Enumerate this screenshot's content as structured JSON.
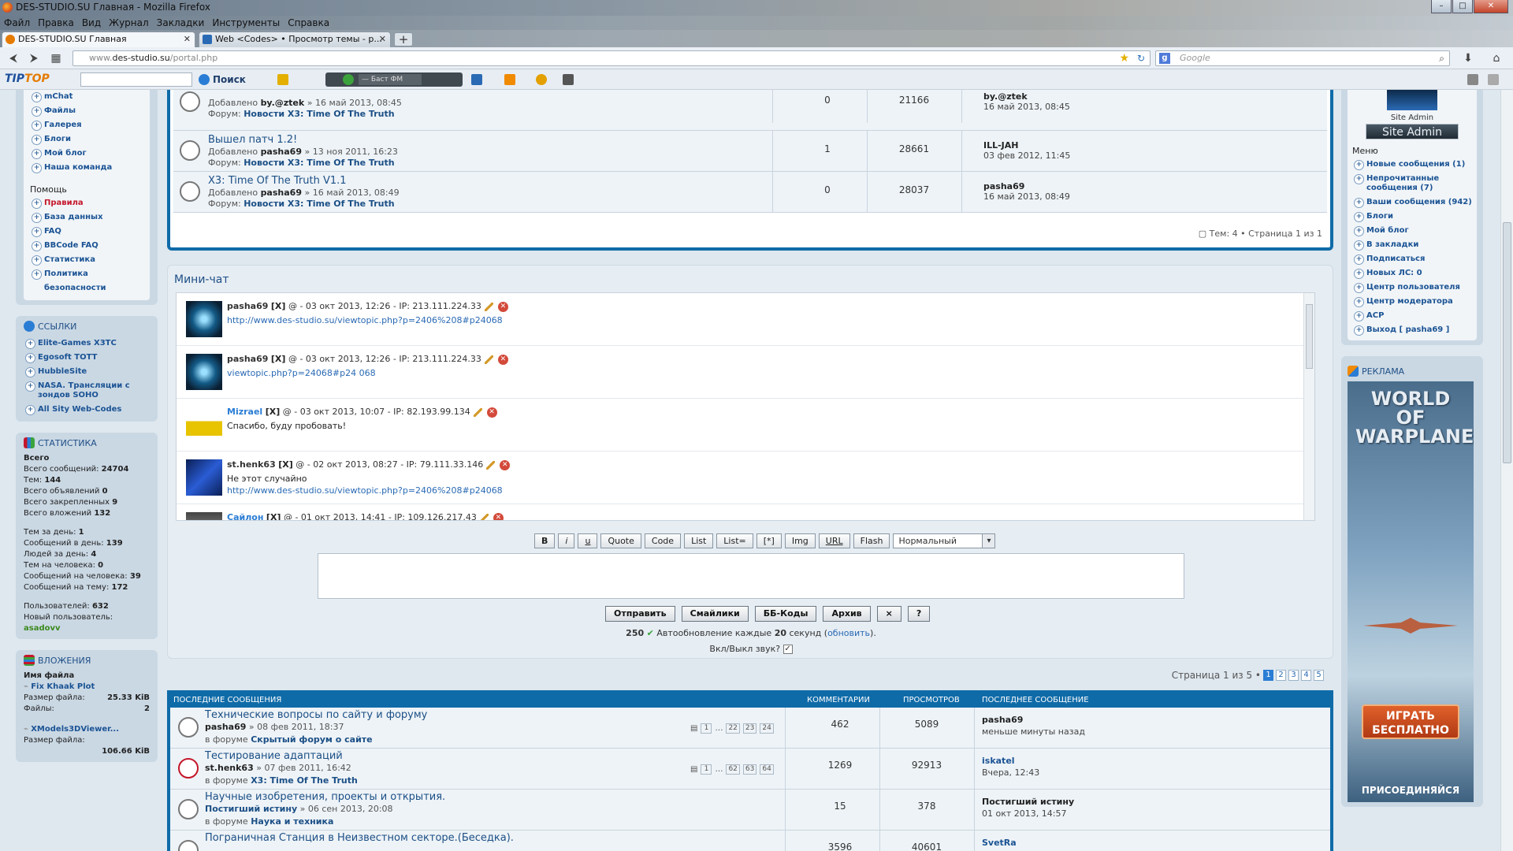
{
  "window": {
    "title": "DES-STUDIO.SU Главная - Mozilla Firefox",
    "controls": [
      "–",
      "□",
      "✕"
    ]
  },
  "menu": [
    "Файл",
    "Правка",
    "Вид",
    "Журнал",
    "Закладки",
    "Инструменты",
    "Справка"
  ],
  "tabs": [
    {
      "label": "DES-STUDIO.SU Главная",
      "close": "✕"
    },
    {
      "label": "Web <Codes> • Просмотр темы - р...",
      "close": "✕"
    }
  ],
  "newtab": "+",
  "nav": {
    "back": "⮜",
    "forward": "⮞",
    "url_host": "www.",
    "url_domain": "des-studio.su",
    "url_path": "/portal.php",
    "search_placeholder": "Google",
    "search_engine": "g"
  },
  "toolbar2": {
    "logo_a": "TIP",
    "logo_b": "TOP",
    "search_label": "Поиск",
    "radio_station": "— Баст ФМ"
  },
  "left": {
    "nav_links": [
      "mChat",
      "Файлы",
      "Галерея",
      "Блоги",
      "Мой блог",
      "Наша команда"
    ],
    "help_title": "Помощь",
    "help_links": [
      {
        "label": "Правила",
        "red": true
      },
      {
        "label": "База данных"
      },
      {
        "label": "FAQ"
      },
      {
        "label": "BBCode FAQ"
      },
      {
        "label": "Статистика"
      },
      {
        "label": "Политика безопасности"
      }
    ],
    "links_title": "ССЫЛКИ",
    "links": [
      "Elite-Games X3TC",
      "Egosoft TOTT",
      "HubbleSite",
      "NASA. Трансляции с зондов SOHO",
      "All Sity Web-Codes"
    ],
    "stats_title": "СТАТИСТИКА",
    "stats": [
      [
        "Всего",
        ""
      ],
      [
        "Всего сообщений: ",
        "24704"
      ],
      [
        "Тем: ",
        "144"
      ],
      [
        "Всего объявлений ",
        "0"
      ],
      [
        "Всего закрепленных ",
        "9"
      ],
      [
        "Всего вложений ",
        "132"
      ],
      [
        "",
        ""
      ],
      [
        "Тем за день: ",
        "1"
      ],
      [
        "Сообщений в день: ",
        "139"
      ],
      [
        "Людей за день: ",
        "4"
      ],
      [
        "Тем на человека: ",
        "0"
      ],
      [
        "Сообщений на человека: ",
        "39"
      ],
      [
        "Сообщений на тему: ",
        "172"
      ],
      [
        "",
        ""
      ],
      [
        "Пользователей: ",
        "632"
      ],
      [
        "Новый пользователь: ",
        ""
      ]
    ],
    "new_user": "asadovv",
    "attach_title": "ВЛОЖЕНИЯ",
    "attach_file_label": "Имя файла",
    "attach_files": [
      {
        "name": "Fix Khaak Plot",
        "size_label": "Размер файла:",
        "size": "25.33 KiB",
        "dl_label": "Файлы:",
        "dl": "2"
      },
      {
        "name": "XModels3DViewer...",
        "size_label": "Размер файла:",
        "size": "106.66 KiB"
      }
    ]
  },
  "topics": [
    {
      "title": "",
      "by_label": "Добавлено",
      "author": "by.@ztek",
      "date": "» 16 май 2013, 08:45",
      "forum_label": "Форум:",
      "forum": "Новости X3: Time Of The Truth",
      "replies": "0",
      "views": "21166",
      "last_user": "by.@ztek",
      "last_date": "16 май 2013, 08:45"
    },
    {
      "title": "Вышел патч 1.2!",
      "by_label": "Добавлено",
      "author": "pasha69",
      "date": "» 13 ноя 2011, 16:23",
      "forum_label": "Форум:",
      "forum": "Новости X3: Time Of The Truth",
      "replies": "1",
      "views": "28661",
      "last_user": "ILL-JAH",
      "last_date": "03 фев 2012, 11:45"
    },
    {
      "title": "X3: Time Of The Truth V1.1",
      "by_label": "Добавлено",
      "author": "pasha69",
      "date": "» 16 май 2013, 08:49",
      "forum_label": "Форум:",
      "forum": "Новости X3: Time Of The Truth",
      "replies": "0",
      "views": "28037",
      "last_user": "pasha69",
      "last_date": "16 май 2013, 08:49"
    }
  ],
  "topics_footer": "Тем: 4 • Страница 1 из 1",
  "chat": {
    "title": "Мини-чат",
    "messages": [
      {
        "user": "pasha69",
        "x": "[X]",
        "meta": "@ - 03 окт 2013, 12:26 - IP: 213.111.224.33",
        "text": "http://www.des-studio.su/viewtopic.php?p=2406%208#p24068",
        "link": true
      },
      {
        "user": "pasha69",
        "x": "[X]",
        "meta": "@ - 03 окт 2013, 12:26 - IP: 213.111.224.33",
        "text": "viewtopic.php?p=24068#p24 068",
        "link": true
      },
      {
        "user": "Mizrael",
        "x": "[X]",
        "meta": "@ - 03 окт 2013, 10:07 - IP: 82.193.99.134",
        "text": "Спасибо, буду пробовать!",
        "link": false,
        "blue": true
      },
      {
        "user": "st.henk63",
        "x": "[X]",
        "meta": "@ - 02 окт 2013, 08:27 - IP: 79.111.33.146",
        "text": "Не этот случайно",
        "text2": "http://www.des-studio.su/viewtopic.php?p=2406%208#p24068",
        "link": false
      },
      {
        "user": "Сайлон",
        "x": "[X]",
        "meta": "@ - 01 окт 2013, 14:41 - IP: 109.126.217.43",
        "text": "",
        "link": false,
        "blue": true
      }
    ],
    "bb": [
      "B",
      "i",
      "u",
      "Quote",
      "Code",
      "List",
      "List=",
      "[*]",
      "Img",
      "URL",
      "Flash"
    ],
    "font_size": "Нормальный",
    "actions": [
      "Отправить",
      "Смайлики",
      "ББ-Коды",
      "Архив",
      "×",
      "?"
    ],
    "counter": "250",
    "autoupdate_a": "Автообновление каждые ",
    "autoupdate_n": "20",
    "autoupdate_b": " секунд (",
    "autoupdate_link": "обновить",
    "autoupdate_c": ").",
    "sound": "Вкл/Выкл звук?",
    "sound_check": "✓"
  },
  "pager": {
    "label": "Страница 1 из 5 •",
    "pages": [
      "1",
      "2",
      "3",
      "4",
      "5"
    ]
  },
  "latest": {
    "headers": [
      "ПОСЛЕДНИЕ СООБЩЕНИЯ",
      "КОММЕНТАРИИ",
      "ПРОСМОТРОВ",
      "ПОСЛЕДНЕЕ СООБЩЕНИЕ"
    ],
    "rows": [
      {
        "title": "Технические вопросы по сайту и форуму",
        "author": "pasha69",
        "date": "» 08 фев 2011, 18:37",
        "forum_label": "в форуме",
        "forum": "Скрытый форум о сайте",
        "pages": [
          "1",
          "…",
          "22",
          "23",
          "24"
        ],
        "comments": "462",
        "views": "5089",
        "last_user": "pasha69",
        "last_date": "меньше минуты назад",
        "red": false
      },
      {
        "title": "Тестирование адаптаций",
        "author": "st.henk63",
        "date": "» 07 фев 2011, 16:42",
        "forum_label": "в форуме",
        "forum": "X3: Time Of The Truth",
        "pages": [
          "1",
          "…",
          "62",
          "63",
          "64"
        ],
        "comments": "1269",
        "views": "92913",
        "last_user": "iskatel",
        "last_date": "Вчера, 12:43",
        "red": true
      },
      {
        "title": "Научные изобретения, проекты и открытия.",
        "author": "Постигший истину",
        "date": "» 06 сен 2013, 20:08",
        "forum_label": "в форуме",
        "forum": "Наука и техника",
        "pages": [],
        "comments": "15",
        "views": "378",
        "last_user": "Постигший истину",
        "last_date": "01 окт 2013, 14:57",
        "red": false
      },
      {
        "title": "Пограничная Станция в Неизвестном секторе.(Беседка).",
        "author": "",
        "date": "",
        "forum_label": "",
        "forum": "",
        "pages": [],
        "comments": "3596",
        "views": "40601",
        "last_user": "SvetRa",
        "last_date": "",
        "red": false
      }
    ]
  },
  "right": {
    "role": "Site Admin",
    "role_badge": "Site Admin",
    "menu_title": "Меню",
    "menu": [
      "Новые сообщения (1)",
      "Непрочитанные сообщения (7)",
      "Ваши сообщения (942)",
      "Блоги",
      "Мой блог",
      "В закладки",
      "Подписаться",
      "Новых ЛС: 0",
      "Центр пользователя",
      "Центр модератора",
      "ACP",
      "Выход [ pasha69 ]"
    ],
    "ad_title": "РЕКЛАМА",
    "ad_game": "WORLD OF WARPLANES",
    "ad_button": "ИГРАТЬ БЕСПЛАТНО",
    "ad_join": "ПРИСОЕДИНЯЙСЯ"
  }
}
